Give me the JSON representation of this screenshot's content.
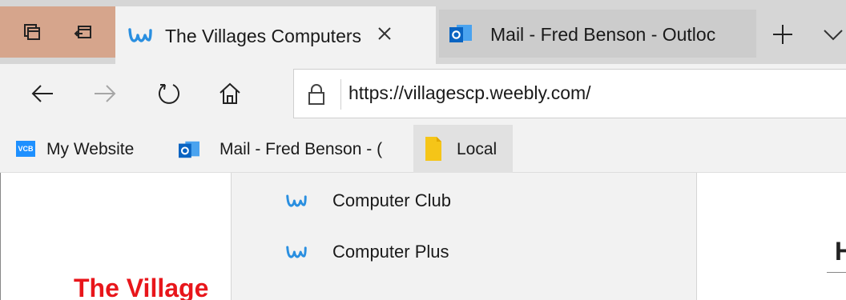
{
  "tabs": {
    "active": {
      "title": "The Villages Computers"
    },
    "inactive": {
      "title": "Mail - Fred Benson - Outloc"
    }
  },
  "navigation": {
    "url": "https://villagescp.weebly.com/"
  },
  "favorites": [
    {
      "label": "My Website",
      "icon": "vcb-icon",
      "icon_text": "VCB"
    },
    {
      "label": "Mail - Fred Benson - (",
      "icon": "outlook-icon"
    },
    {
      "label": "Local",
      "icon": "folder-icon"
    }
  ],
  "dropdown": {
    "items": [
      {
        "label": "Computer Club",
        "icon": "weebly-icon"
      },
      {
        "label": "Computer Plus",
        "icon": "weebly-icon"
      }
    ]
  },
  "page": {
    "heading_partial": "The Village",
    "right_partial": "H"
  },
  "colors": {
    "tab_actions_bg": "#d6a58c",
    "weebly_blue": "#2a8fe0",
    "outlook_blue": "#0a64c2",
    "folder_yellow": "#f5c518",
    "heading_red": "#e8161b"
  }
}
